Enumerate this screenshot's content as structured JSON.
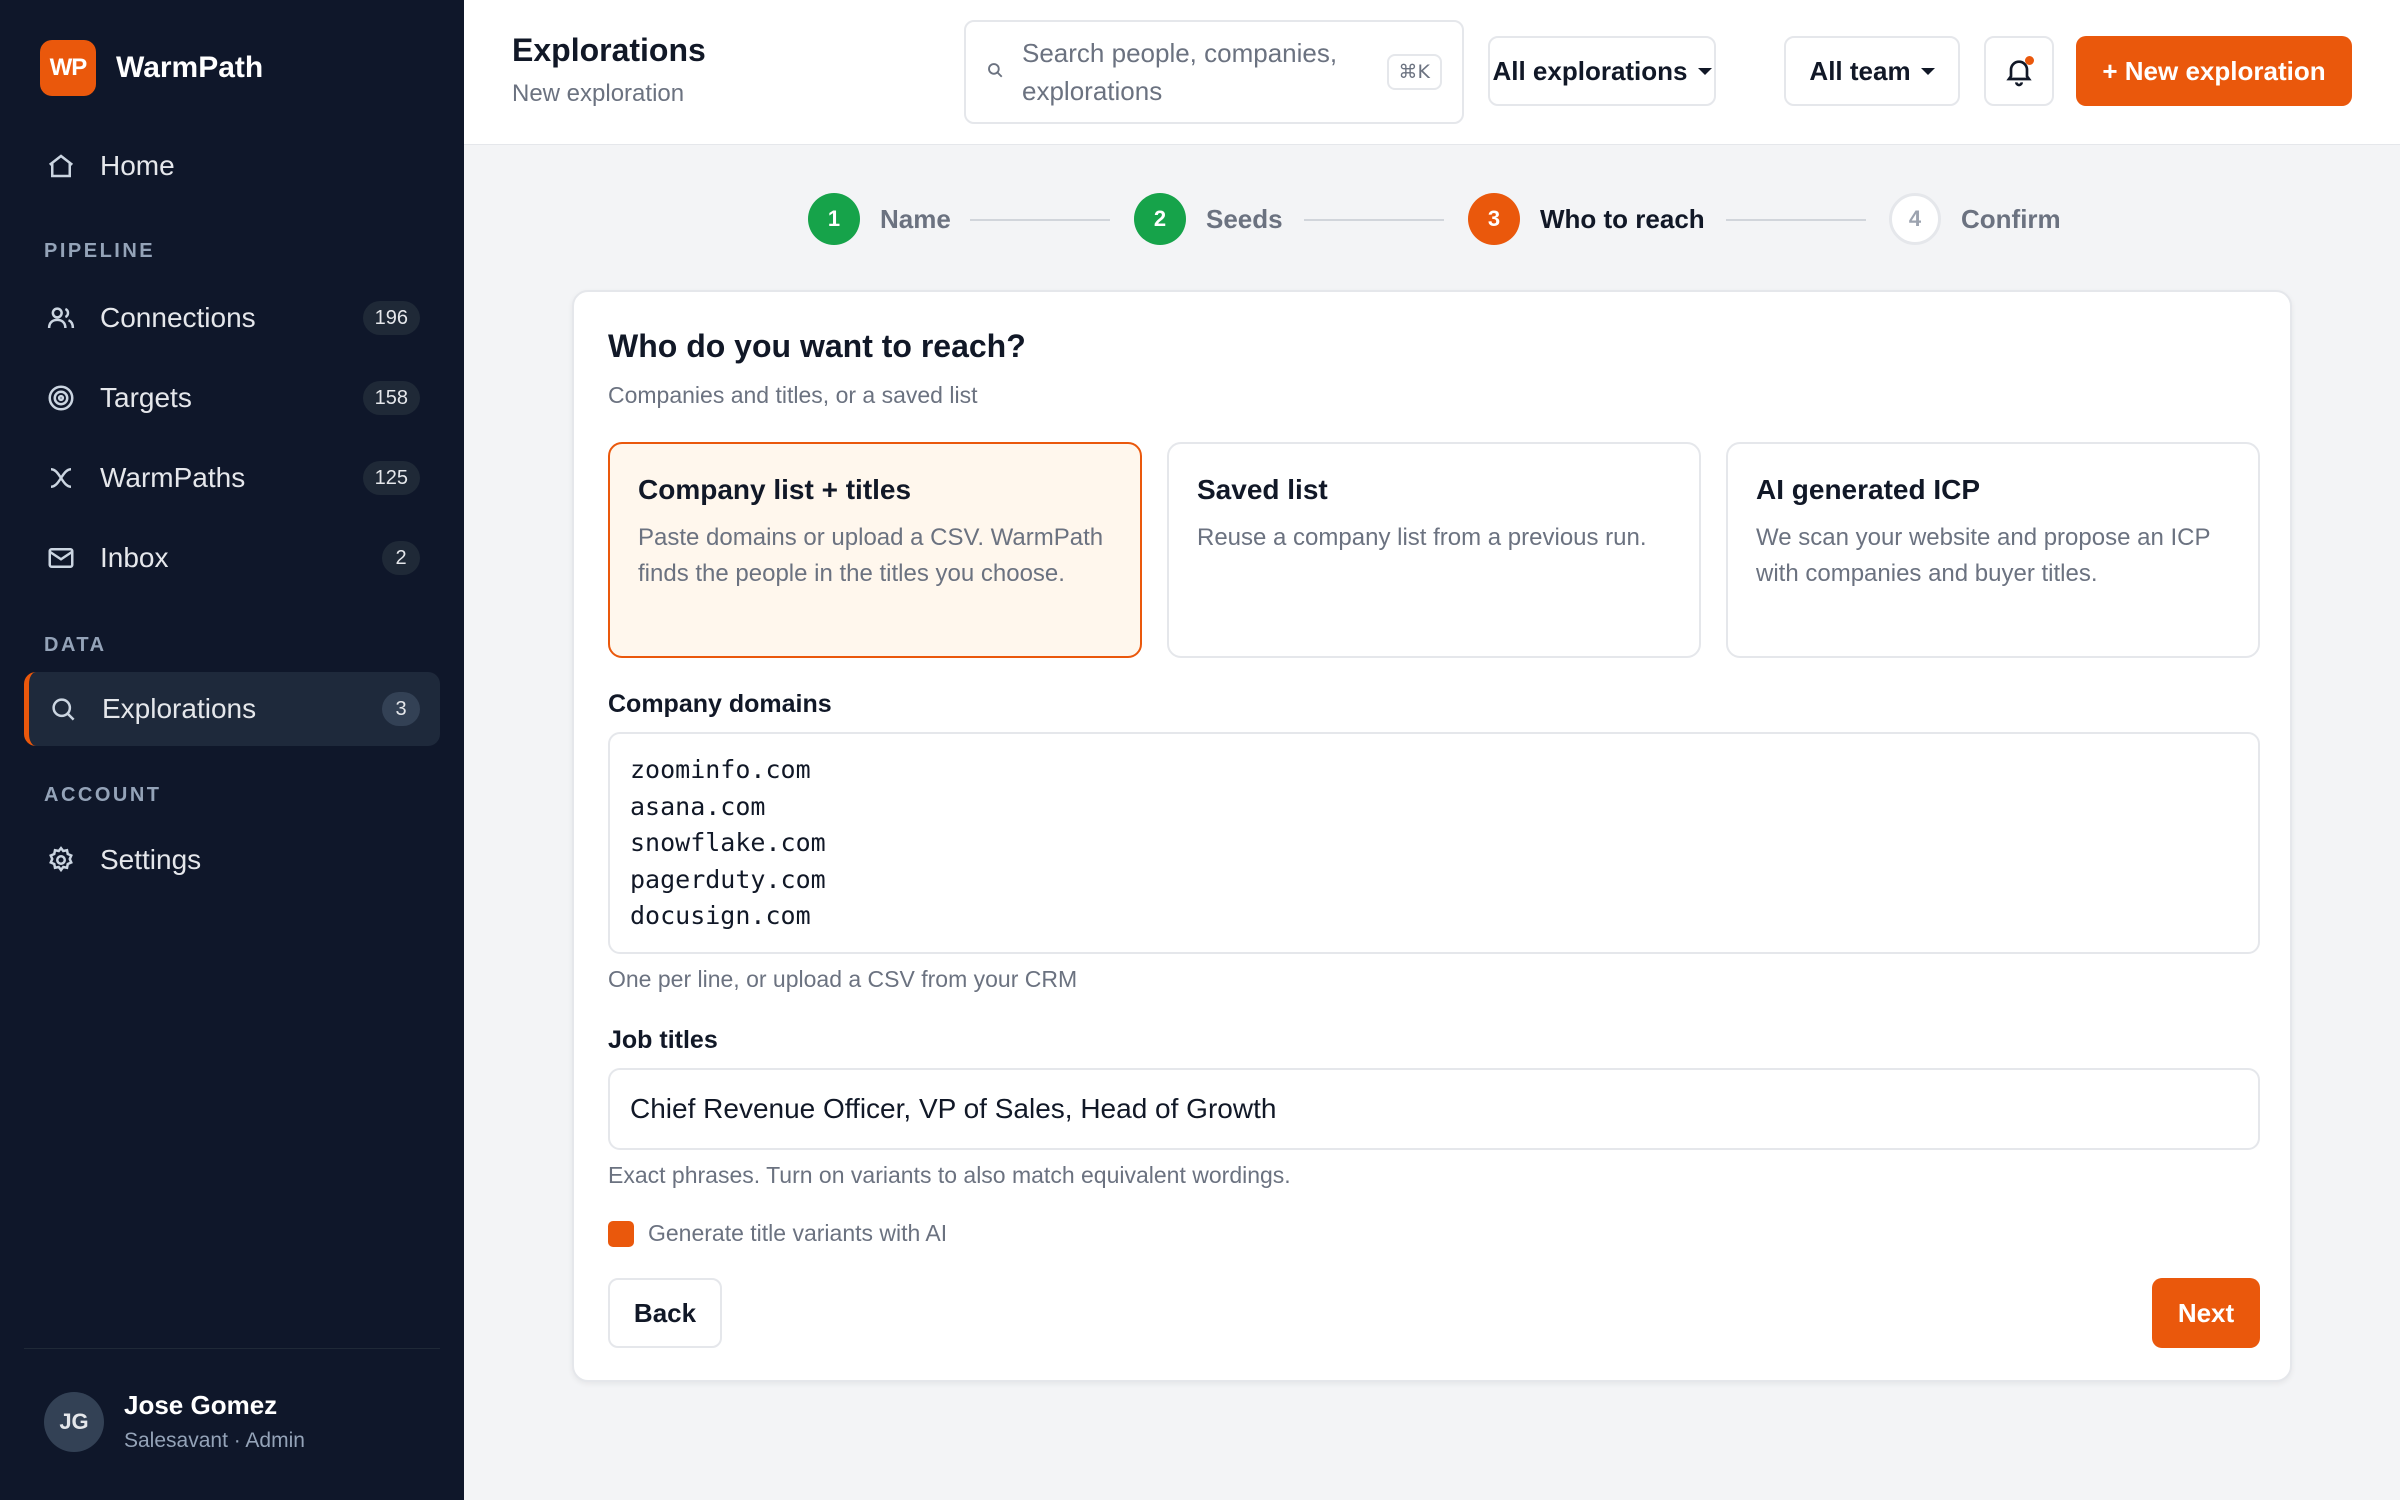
{
  "app": {
    "logo_text": "WP",
    "name": "WarmPath"
  },
  "sidebar": {
    "home": {
      "label": "Home"
    },
    "sections": {
      "pipeline": "PIPELINE",
      "data": "DATA",
      "account": "ACCOUNT"
    },
    "items": [
      {
        "label": "Connections",
        "count": "196",
        "icon": "users-icon"
      },
      {
        "label": "Targets",
        "count": "158",
        "icon": "target-icon"
      },
      {
        "label": "WarmPaths",
        "count": "125",
        "icon": "warmpath-icon"
      },
      {
        "label": "Inbox",
        "count": "2",
        "icon": "mail-icon"
      },
      {
        "label": "Explorations",
        "count": "3",
        "icon": "search-icon",
        "active": true
      },
      {
        "label": "Settings",
        "icon": "gear-icon"
      }
    ],
    "user": {
      "initials": "JG",
      "name": "Jose Gomez",
      "role": "Salesavant · Admin"
    }
  },
  "header": {
    "title": "Explorations",
    "subtitle": "New exploration",
    "search_placeholder": "Search people, companies, explorations",
    "search_shortcut": "⌘K",
    "filter_explorations": "All explorations",
    "filter_team": "All team",
    "new_button": "+ New exploration"
  },
  "stepper": {
    "steps": [
      {
        "number": "1",
        "label": "Name",
        "state": "done"
      },
      {
        "number": "2",
        "label": "Seeds",
        "state": "done"
      },
      {
        "number": "3",
        "label": "Who to reach",
        "state": "current"
      },
      {
        "number": "4",
        "label": "Confirm",
        "state": "todo"
      }
    ]
  },
  "card": {
    "title": "Who do you want to reach?",
    "subtitle": "Companies and titles, or a saved list",
    "options": [
      {
        "title": "Company list + titles",
        "desc": "Paste domains or upload a CSV. WarmPath finds the people in the titles you choose.",
        "selected": true
      },
      {
        "title": "Saved list",
        "desc": "Reuse a company list from a previous run.",
        "selected": false
      },
      {
        "title": "AI generated ICP",
        "desc": "We scan your website and propose an ICP with companies and buyer titles.",
        "selected": false
      }
    ],
    "domains_label": "Company domains",
    "domains_value": "zoominfo.com\nasana.com\nsnowflake.com\npagerduty.com\ndocusign.com",
    "domains_hint": "One per line, or upload a CSV from your CRM",
    "titles_label": "Job titles",
    "titles_value": "Chief Revenue Officer, VP of Sales, Head of Growth",
    "titles_hint": "Exact phrases. Turn on variants to also match equivalent wordings.",
    "ai_variants_label": "Generate title variants with AI",
    "ai_variants_checked": true,
    "back_label": "Back",
    "next_label": "Next"
  },
  "colors": {
    "accent": "#ea580c",
    "sidebar_bg": "#0f172a",
    "success": "#16a34a"
  }
}
